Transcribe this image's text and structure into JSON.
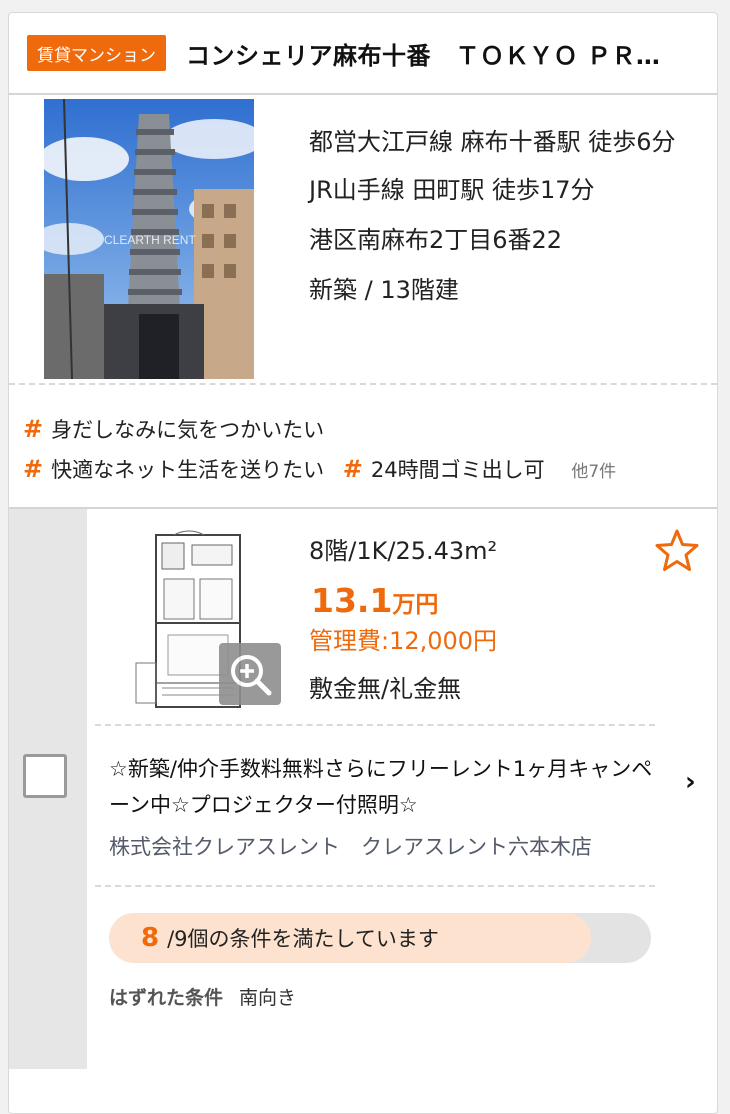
{
  "listing": {
    "type_badge": "賃貸マンション",
    "name": "コンシェリア麻布十番　ＴＯＫＹＯ ＰＲＥＭＩＵＭ",
    "photo_watermark": "CLEARTH RENT",
    "access": [
      "都営大江戸線 麻布十番駅 徒歩6分",
      "JR山手線 田町駅 徒歩17分"
    ],
    "address": "港区南麻布2丁目6番22",
    "building": "新築 / 13階建",
    "tags": [
      "身だしなみに気をつかいたい",
      "快適なネット生活を送りたい",
      "24時間ゴミ出し可"
    ],
    "tags_more": "他7件"
  },
  "room": {
    "spec": "8階/1K/25.43m²",
    "rent_value": "13.1",
    "rent_unit": "万円",
    "management_fee": "管理費:12,000円",
    "deposit_key": "敷金無/礼金無",
    "pr_text": "☆新築/仲介手数料無料さらにフリーレント1ヶ月キャンペーン中☆プロジェクター付照明☆",
    "agent": "株式会社クレアスレント　クレアスレント六本木店",
    "match_count": "8",
    "match_suffix": "/9個の条件を満たしています",
    "match_ratio": 0.889,
    "unmet_label": "はずれた条件",
    "unmet_value": "南向き"
  },
  "colors": {
    "accent": "#ee6a0d",
    "match_fill": "#fde3cf"
  },
  "icons": [
    "star-outline-icon",
    "zoom-in-icon",
    "chevron-right-icon",
    "hash-icon",
    "checkbox-icon"
  ]
}
